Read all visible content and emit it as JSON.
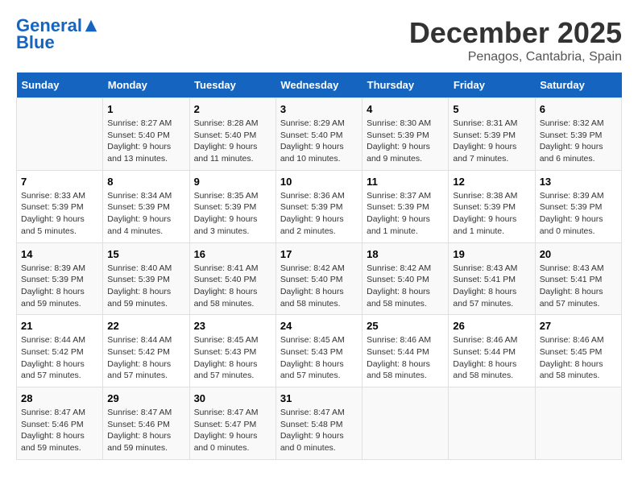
{
  "header": {
    "logo_line1": "General",
    "logo_line2": "Blue",
    "month": "December 2025",
    "location": "Penagos, Cantabria, Spain"
  },
  "weekdays": [
    "Sunday",
    "Monday",
    "Tuesday",
    "Wednesday",
    "Thursday",
    "Friday",
    "Saturday"
  ],
  "weeks": [
    [
      {
        "day": "",
        "info": ""
      },
      {
        "day": "1",
        "info": "Sunrise: 8:27 AM\nSunset: 5:40 PM\nDaylight: 9 hours\nand 13 minutes."
      },
      {
        "day": "2",
        "info": "Sunrise: 8:28 AM\nSunset: 5:40 PM\nDaylight: 9 hours\nand 11 minutes."
      },
      {
        "day": "3",
        "info": "Sunrise: 8:29 AM\nSunset: 5:40 PM\nDaylight: 9 hours\nand 10 minutes."
      },
      {
        "day": "4",
        "info": "Sunrise: 8:30 AM\nSunset: 5:39 PM\nDaylight: 9 hours\nand 9 minutes."
      },
      {
        "day": "5",
        "info": "Sunrise: 8:31 AM\nSunset: 5:39 PM\nDaylight: 9 hours\nand 7 minutes."
      },
      {
        "day": "6",
        "info": "Sunrise: 8:32 AM\nSunset: 5:39 PM\nDaylight: 9 hours\nand 6 minutes."
      }
    ],
    [
      {
        "day": "7",
        "info": "Sunrise: 8:33 AM\nSunset: 5:39 PM\nDaylight: 9 hours\nand 5 minutes."
      },
      {
        "day": "8",
        "info": "Sunrise: 8:34 AM\nSunset: 5:39 PM\nDaylight: 9 hours\nand 4 minutes."
      },
      {
        "day": "9",
        "info": "Sunrise: 8:35 AM\nSunset: 5:39 PM\nDaylight: 9 hours\nand 3 minutes."
      },
      {
        "day": "10",
        "info": "Sunrise: 8:36 AM\nSunset: 5:39 PM\nDaylight: 9 hours\nand 2 minutes."
      },
      {
        "day": "11",
        "info": "Sunrise: 8:37 AM\nSunset: 5:39 PM\nDaylight: 9 hours\nand 1 minute."
      },
      {
        "day": "12",
        "info": "Sunrise: 8:38 AM\nSunset: 5:39 PM\nDaylight: 9 hours\nand 1 minute."
      },
      {
        "day": "13",
        "info": "Sunrise: 8:39 AM\nSunset: 5:39 PM\nDaylight: 9 hours\nand 0 minutes."
      }
    ],
    [
      {
        "day": "14",
        "info": "Sunrise: 8:39 AM\nSunset: 5:39 PM\nDaylight: 8 hours\nand 59 minutes."
      },
      {
        "day": "15",
        "info": "Sunrise: 8:40 AM\nSunset: 5:39 PM\nDaylight: 8 hours\nand 59 minutes."
      },
      {
        "day": "16",
        "info": "Sunrise: 8:41 AM\nSunset: 5:40 PM\nDaylight: 8 hours\nand 58 minutes."
      },
      {
        "day": "17",
        "info": "Sunrise: 8:42 AM\nSunset: 5:40 PM\nDaylight: 8 hours\nand 58 minutes."
      },
      {
        "day": "18",
        "info": "Sunrise: 8:42 AM\nSunset: 5:40 PM\nDaylight: 8 hours\nand 58 minutes."
      },
      {
        "day": "19",
        "info": "Sunrise: 8:43 AM\nSunset: 5:41 PM\nDaylight: 8 hours\nand 57 minutes."
      },
      {
        "day": "20",
        "info": "Sunrise: 8:43 AM\nSunset: 5:41 PM\nDaylight: 8 hours\nand 57 minutes."
      }
    ],
    [
      {
        "day": "21",
        "info": "Sunrise: 8:44 AM\nSunset: 5:42 PM\nDaylight: 8 hours\nand 57 minutes."
      },
      {
        "day": "22",
        "info": "Sunrise: 8:44 AM\nSunset: 5:42 PM\nDaylight: 8 hours\nand 57 minutes."
      },
      {
        "day": "23",
        "info": "Sunrise: 8:45 AM\nSunset: 5:43 PM\nDaylight: 8 hours\nand 57 minutes."
      },
      {
        "day": "24",
        "info": "Sunrise: 8:45 AM\nSunset: 5:43 PM\nDaylight: 8 hours\nand 57 minutes."
      },
      {
        "day": "25",
        "info": "Sunrise: 8:46 AM\nSunset: 5:44 PM\nDaylight: 8 hours\nand 58 minutes."
      },
      {
        "day": "26",
        "info": "Sunrise: 8:46 AM\nSunset: 5:44 PM\nDaylight: 8 hours\nand 58 minutes."
      },
      {
        "day": "27",
        "info": "Sunrise: 8:46 AM\nSunset: 5:45 PM\nDaylight: 8 hours\nand 58 minutes."
      }
    ],
    [
      {
        "day": "28",
        "info": "Sunrise: 8:47 AM\nSunset: 5:46 PM\nDaylight: 8 hours\nand 59 minutes."
      },
      {
        "day": "29",
        "info": "Sunrise: 8:47 AM\nSunset: 5:46 PM\nDaylight: 8 hours\nand 59 minutes."
      },
      {
        "day": "30",
        "info": "Sunrise: 8:47 AM\nSunset: 5:47 PM\nDaylight: 9 hours\nand 0 minutes."
      },
      {
        "day": "31",
        "info": "Sunrise: 8:47 AM\nSunset: 5:48 PM\nDaylight: 9 hours\nand 0 minutes."
      },
      {
        "day": "",
        "info": ""
      },
      {
        "day": "",
        "info": ""
      },
      {
        "day": "",
        "info": ""
      }
    ]
  ]
}
